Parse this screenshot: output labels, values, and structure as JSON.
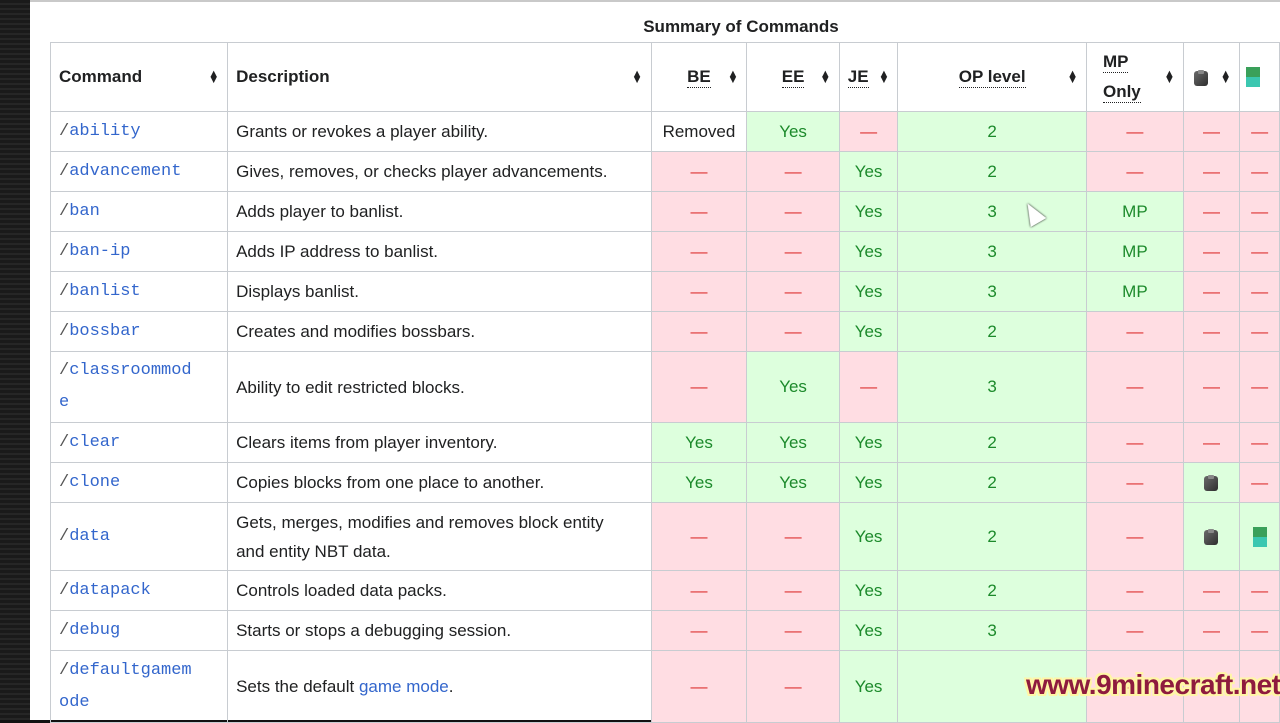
{
  "caption": "Summary of Commands",
  "headers": {
    "command": "Command",
    "description": "Description",
    "be": "BE",
    "ee": "EE",
    "je": "JE",
    "op": "OP level",
    "mp_line1": "MP",
    "mp_line2": "Only",
    "block_col": "command-block-icon",
    "mob_col": "mob-icon"
  },
  "rows": [
    {
      "cmd": "ability",
      "desc": "Grants or revokes a player ability.",
      "be": "Removed",
      "ee": "Yes",
      "je": "—",
      "op": "2",
      "mp": "—",
      "blk": "—",
      "mob": "—"
    },
    {
      "cmd": "advancement",
      "desc": "Gives, removes, or checks player advancements.",
      "be": "—",
      "ee": "—",
      "je": "Yes",
      "op": "2",
      "mp": "—",
      "blk": "—",
      "mob": "—"
    },
    {
      "cmd": "ban",
      "desc": "Adds player to banlist.",
      "be": "—",
      "ee": "—",
      "je": "Yes",
      "op": "3",
      "mp": "MP",
      "blk": "—",
      "mob": "—"
    },
    {
      "cmd": "ban-ip",
      "desc": "Adds IP address to banlist.",
      "be": "—",
      "ee": "—",
      "je": "Yes",
      "op": "3",
      "mp": "MP",
      "blk": "—",
      "mob": "—"
    },
    {
      "cmd": "banlist",
      "desc": "Displays banlist.",
      "be": "—",
      "ee": "—",
      "je": "Yes",
      "op": "3",
      "mp": "MP",
      "blk": "—",
      "mob": "—"
    },
    {
      "cmd": "bossbar",
      "desc": "Creates and modifies bossbars.",
      "be": "—",
      "ee": "—",
      "je": "Yes",
      "op": "2",
      "mp": "—",
      "blk": "—",
      "mob": "—"
    },
    {
      "cmd": "classroommode",
      "cmd_l1": "classroommod",
      "cmd_l2": "e",
      "desc": "Ability to edit restricted blocks.",
      "be": "—",
      "ee": "Yes",
      "je": "—",
      "op": "3",
      "mp": "—",
      "blk": "—",
      "mob": "—"
    },
    {
      "cmd": "clear",
      "desc": "Clears items from player inventory.",
      "be": "Yes",
      "ee": "Yes",
      "je": "Yes",
      "op": "2",
      "mp": "—",
      "blk": "—",
      "mob": "—"
    },
    {
      "cmd": "clone",
      "desc": "Copies blocks from one place to another.",
      "be": "Yes",
      "ee": "Yes",
      "je": "Yes",
      "op": "2",
      "mp": "—",
      "blk": "icon",
      "mob": "—"
    },
    {
      "cmd": "data",
      "desc_l1": "Gets, merges, modifies and removes block entity",
      "desc_l2": "and entity NBT data.",
      "be": "—",
      "ee": "—",
      "je": "Yes",
      "op": "2",
      "mp": "—",
      "blk": "icon",
      "mob": "icon"
    },
    {
      "cmd": "datapack",
      "desc": "Controls loaded data packs.",
      "be": "—",
      "ee": "—",
      "je": "Yes",
      "op": "2",
      "mp": "—",
      "blk": "—",
      "mob": "—"
    },
    {
      "cmd": "debug",
      "desc": "Starts or stops a debugging session.",
      "be": "—",
      "ee": "—",
      "je": "Yes",
      "op": "3",
      "mp": "—",
      "blk": "—",
      "mob": "—"
    },
    {
      "cmd": "defaultgamemode",
      "cmd_l1": "defaultgamem",
      "cmd_l2": "ode",
      "desc_pre": "Sets the default ",
      "desc_link": "game mode",
      "desc_post": ".",
      "be": "—",
      "ee": "—",
      "je": "Yes",
      "op": "",
      "mp": "—",
      "blk": "—",
      "mob": "—"
    }
  ],
  "watermark": "www.9minecraft.net"
}
